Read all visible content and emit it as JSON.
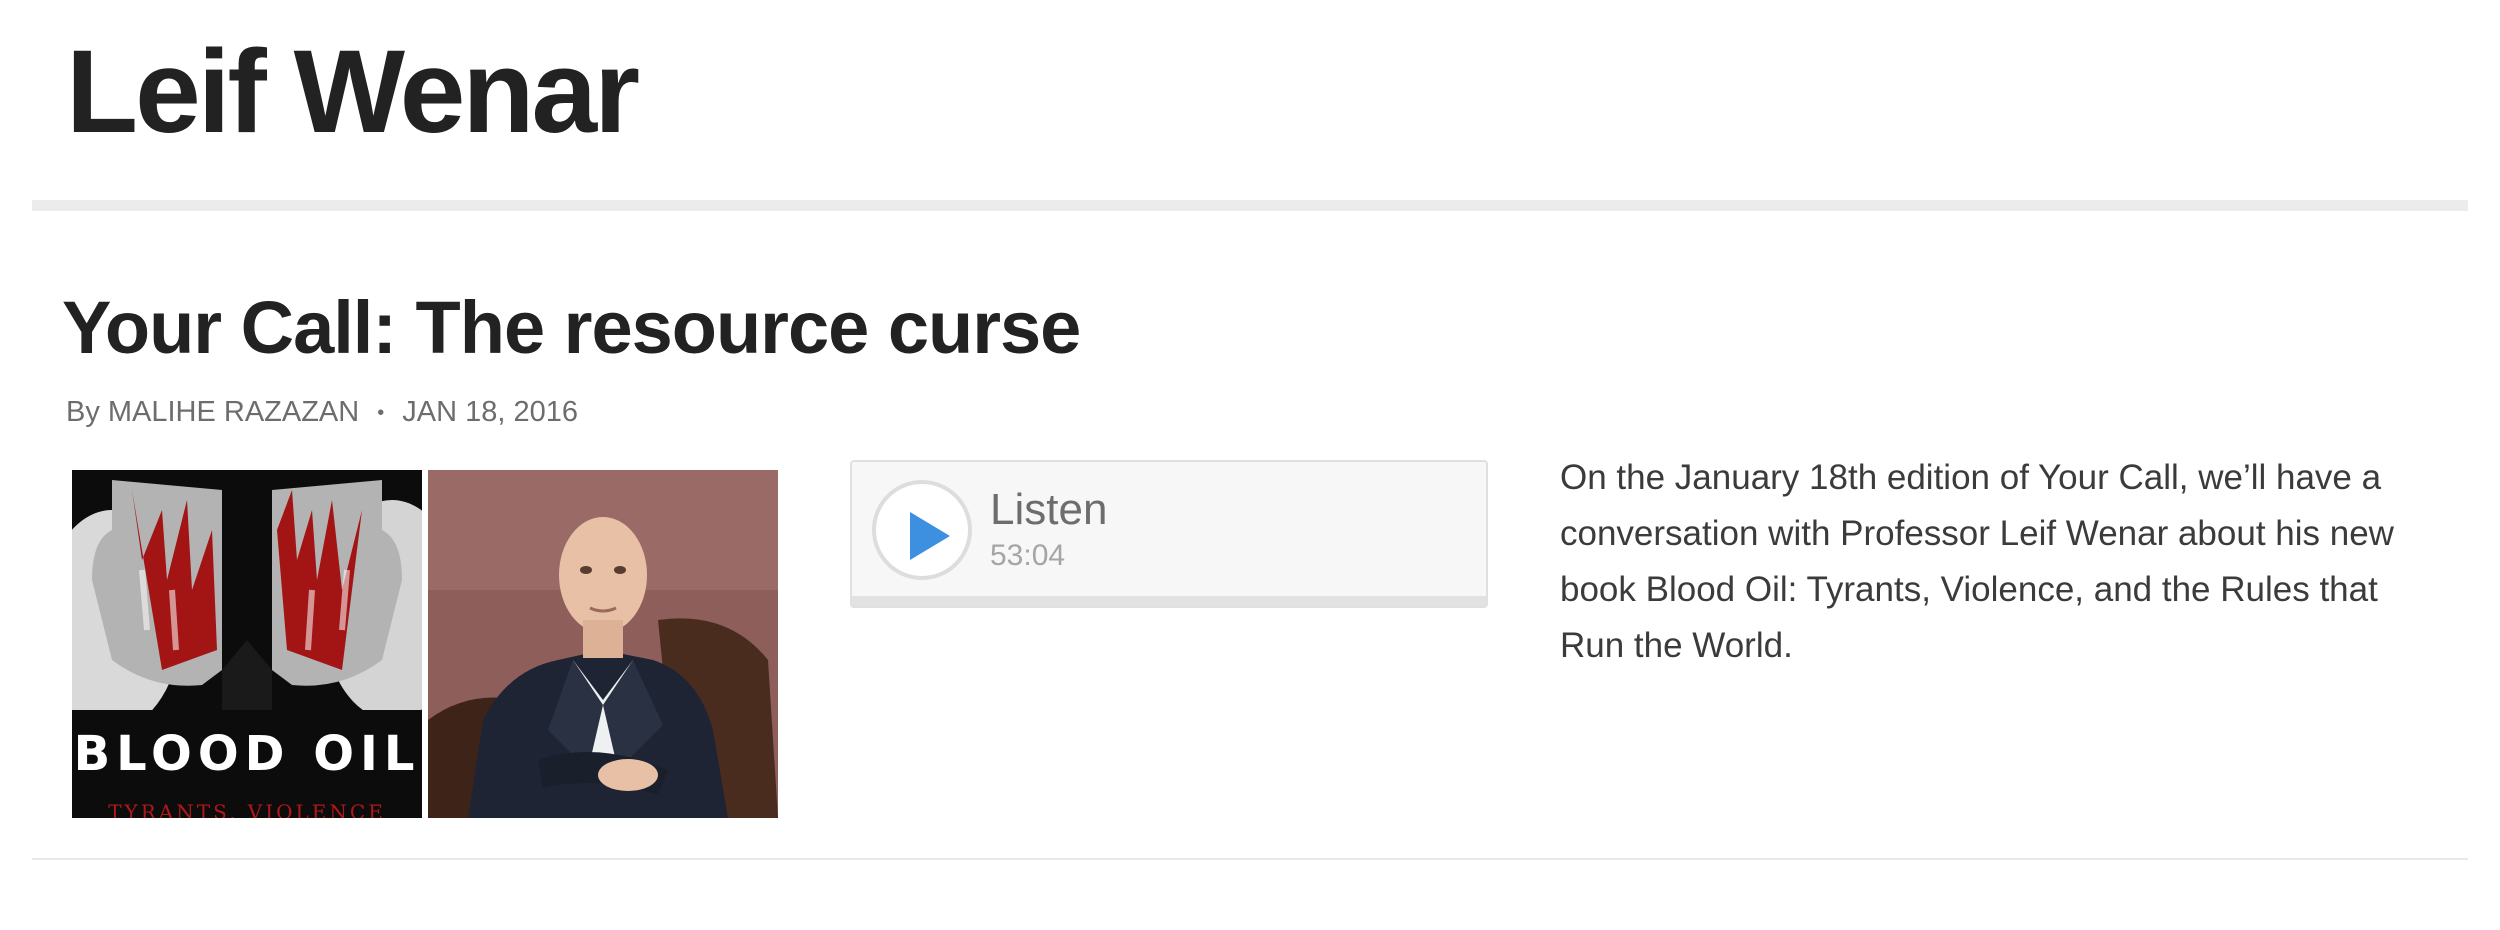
{
  "page": {
    "title": "Leif Wenar"
  },
  "story": {
    "title": "Your Call: The resource curse",
    "byline_prefix": "By",
    "author": "MALIHE RAZAZAN",
    "separator": "•",
    "date": "JAN 18, 2016",
    "teaser": "On the January 18th edition of Your Call, we’ll have a conversation with Professor Leif Wenar about his new book Blood Oil: Tyrants, Violence, and the Rules that Run the World."
  },
  "images": {
    "book_cover": {
      "title": "BLOOD OIL",
      "subtitle": "TYRANTS, VIOLENCE"
    }
  },
  "audio": {
    "label": "Listen",
    "duration": "53:04",
    "progress": 0,
    "accent_color": "#3d8fe0"
  },
  "icons": {
    "play": "play-icon"
  }
}
